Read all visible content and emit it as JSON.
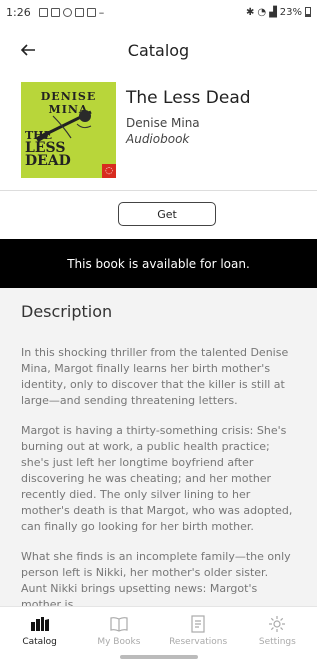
{
  "status_bar": {
    "time": "1:26",
    "battery": "23%"
  },
  "app_bar": {
    "title": "Catalog",
    "back_icon": "arrow-left-icon"
  },
  "book": {
    "title": "The Less Dead",
    "author": "Denise Mina",
    "format": "Audiobook",
    "cover": {
      "author_text": "DENISE MINA",
      "title_line1": "THE",
      "title_line2": "LESS DEAD",
      "background": "#b8d63a"
    }
  },
  "actions": {
    "get_label": "Get"
  },
  "availability": {
    "message": "This book is available for loan."
  },
  "description": {
    "heading": "Description",
    "paragraphs": [
      "In this shocking thriller from the talented Denise Mina, Margot finally learns her birth mother's identity, only to discover that the killer is still at large—and sending threatening letters.",
      "Margot is having a thirty-something crisis: She's burning out at work, a public health practice; she's just left her longtime boyfriend after discovering he was cheating; and her mother recently died. The only silver lining to her mother's death is that Margot, who was adopted, can finally go looking for her birth mother.",
      "What she finds is an incomplete family—the only person left is Nikki, her mother's older sister. Aunt Nikki brings upsetting news: Margot's mother is"
    ]
  },
  "bottom_nav": {
    "items": [
      {
        "label": "Catalog",
        "icon": "catalog-icon",
        "active": true
      },
      {
        "label": "My Books",
        "icon": "book-icon",
        "active": false
      },
      {
        "label": "Reservations",
        "icon": "reservations-icon",
        "active": false
      },
      {
        "label": "Settings",
        "icon": "gear-icon",
        "active": false
      }
    ]
  },
  "colors": {
    "banner_bg": "#000000",
    "description_bg": "#f3f3f3",
    "accent": "#222222"
  }
}
